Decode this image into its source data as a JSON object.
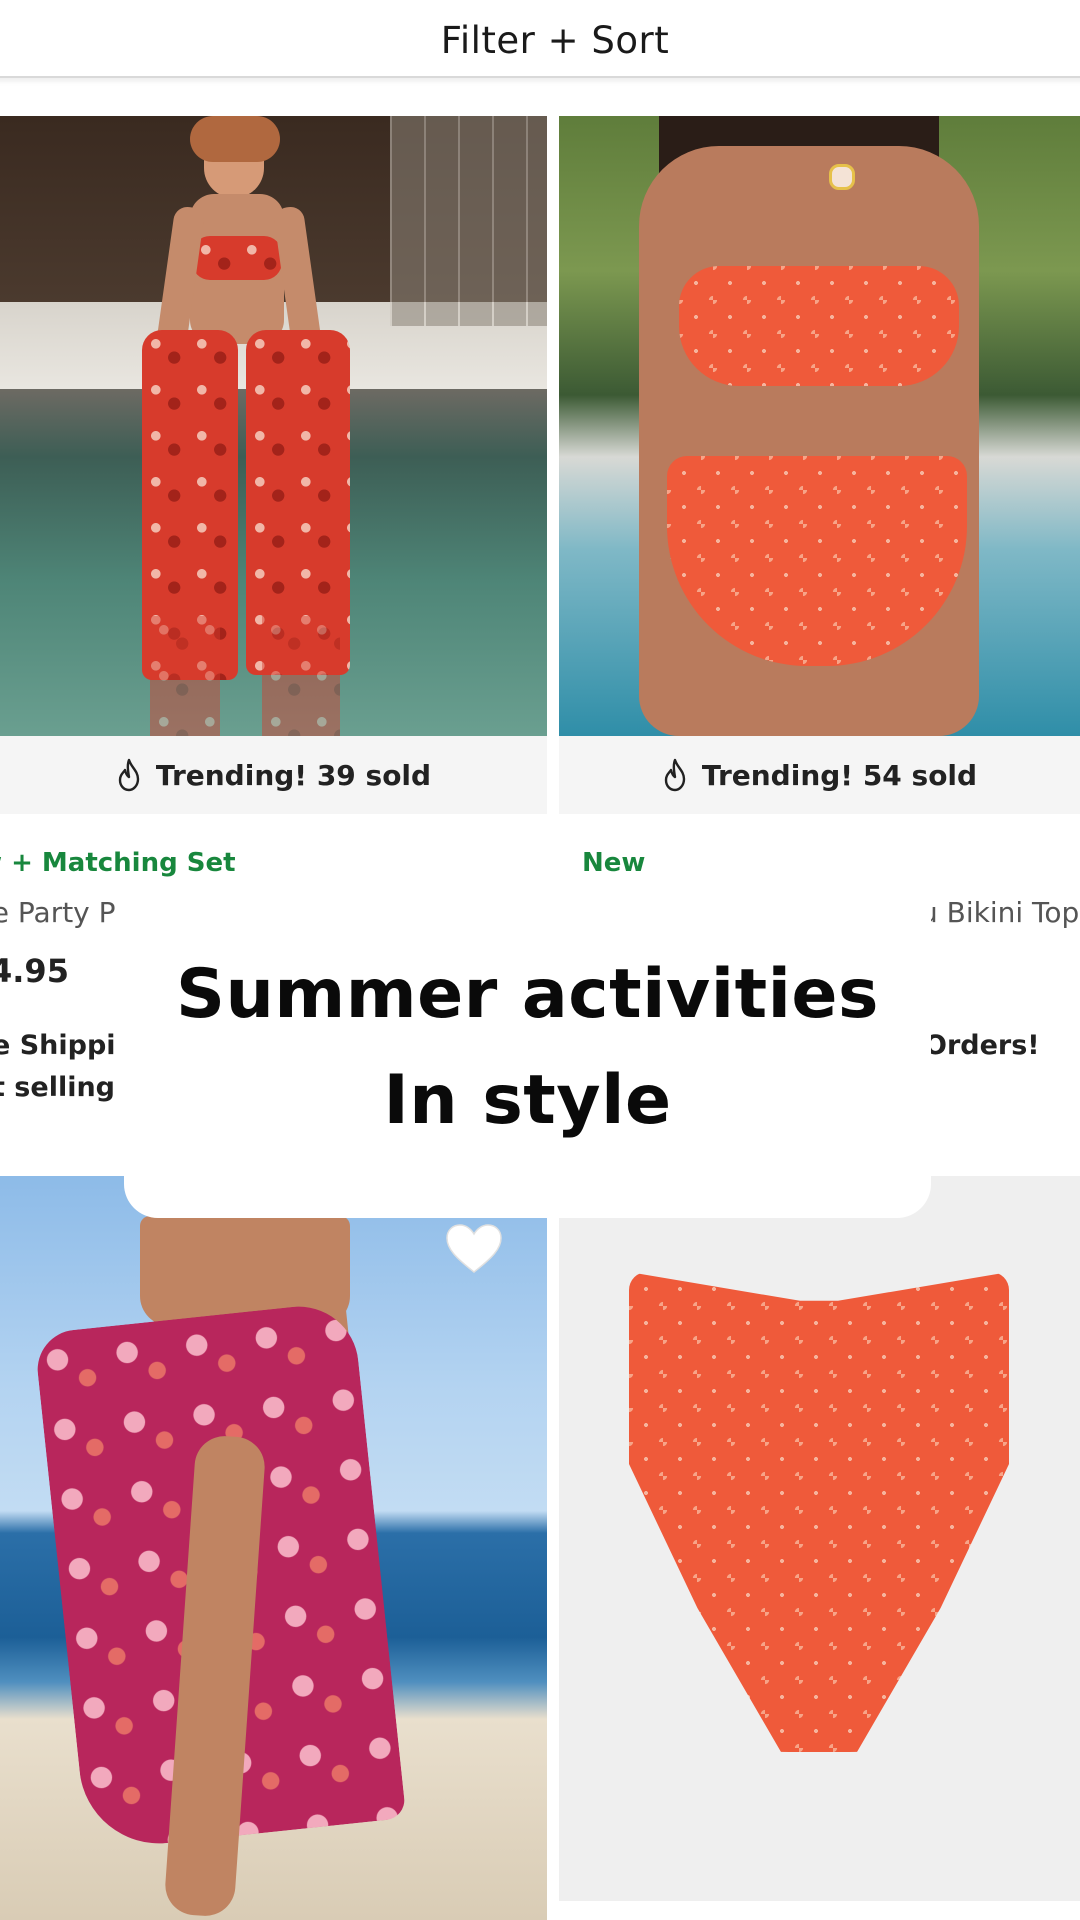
{
  "toolbar": {
    "filter_sort_label": "Filter + Sort"
  },
  "products": [
    {
      "badge": "Trending! 39 sold",
      "tag": "w + Matching Set",
      "name": "ie Party P",
      "price": "4.95",
      "promo_lines": [
        "e Shippi",
        "t selling"
      ]
    },
    {
      "badge": "Trending! 54 sold",
      "tag": "New",
      "name": "u Bikini Top",
      "promo_lines": [
        "Orders!"
      ]
    },
    {
      "favorited": false
    },
    {}
  ],
  "overlay": {
    "line1": "Summer activities",
    "line2": "In style"
  },
  "colors": {
    "tag_green": "#18873d",
    "badge_bg": "#f5f5f5"
  },
  "icons": [
    "flame-icon",
    "heart-icon"
  ]
}
